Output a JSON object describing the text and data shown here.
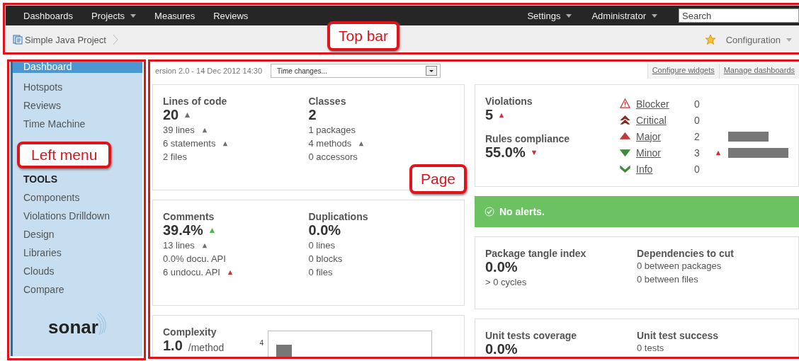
{
  "nav": {
    "items": [
      {
        "label": "Dashboards",
        "menu": false
      },
      {
        "label": "Projects",
        "menu": true
      },
      {
        "label": "Measures",
        "menu": false
      },
      {
        "label": "Reviews",
        "menu": false
      }
    ],
    "right": [
      {
        "label": "Settings",
        "menu": true
      },
      {
        "label": "Administrator",
        "menu": true
      }
    ],
    "search": {
      "placeholder": "Search"
    }
  },
  "breadcrumb": {
    "project": "Simple Java Project",
    "configuration": "Configuration"
  },
  "sidebar": {
    "items": [
      {
        "label": "Dashboard",
        "selected": true
      },
      {
        "label": "Hotspots",
        "selected": false
      },
      {
        "label": "Reviews",
        "selected": false
      },
      {
        "label": "Time Machine",
        "selected": false
      }
    ],
    "section": "TOOLS",
    "tools": [
      {
        "label": "Components",
        "selected": false
      },
      {
        "label": "Violations Drilldown",
        "selected": false
      },
      {
        "label": "Design",
        "selected": false
      },
      {
        "label": "Libraries",
        "selected": false
      },
      {
        "label": "Clouds",
        "selected": false
      },
      {
        "label": "Compare",
        "selected": false
      }
    ],
    "logo": "sonar"
  },
  "header": {
    "version": "ersion 2.0 - 14 Dec 2012 14:30",
    "time_select": "Time changes...",
    "links": [
      "Configure widgets",
      "Manage dashboards"
    ]
  },
  "left_widgets": [
    {
      "kind": "metrics",
      "columns": [
        {
          "title": "Lines of code",
          "value": "20",
          "trend": {
            "kind": "up",
            "color": "#6f6f6f"
          },
          "lines": [
            {
              "text": "39 lines",
              "trend": {
                "kind": "up",
                "color": "#6f6f6f"
              }
            },
            {
              "text": "6 statements",
              "trend": {
                "kind": "up",
                "color": "#6f6f6f"
              }
            },
            {
              "text": "2 files"
            }
          ]
        },
        {
          "title": "Classes",
          "value": "2",
          "lines": [
            {
              "text": "1 packages"
            },
            {
              "text": "4 methods",
              "trend": {
                "kind": "up",
                "color": "#6f6f6f"
              }
            },
            {
              "text": "0 accessors"
            }
          ]
        }
      ]
    },
    {
      "kind": "metrics",
      "columns": [
        {
          "title": "Comments",
          "value": "39.4%",
          "trend": {
            "kind": "up",
            "color": "#4fb848"
          },
          "lines": [
            {
              "text": "13 lines",
              "trend": {
                "kind": "up",
                "color": "#6f6f6f"
              }
            },
            {
              "text": "0.0% docu. API"
            },
            {
              "text": "6 undocu. API",
              "trend": {
                "kind": "up",
                "color": "#d0303a"
              }
            }
          ]
        },
        {
          "title": "Duplications",
          "value": "0.0%",
          "lines": [
            {
              "text": "0 lines"
            },
            {
              "text": "0 blocks"
            },
            {
              "text": "0 files"
            }
          ]
        }
      ]
    },
    {
      "kind": "complexity",
      "title": "Complexity",
      "value": "1.0",
      "unit": "/method",
      "chart_tick": "4"
    }
  ],
  "right_widgets": [
    {
      "kind": "violations",
      "title": "Violations",
      "value": "5",
      "trend": {
        "kind": "up",
        "color": "#d0303a"
      },
      "subtitle": "Rules compliance",
      "subvalue": "55.0%",
      "subtrend": {
        "kind": "down",
        "color": "#d0303a"
      },
      "severities": [
        {
          "kind": "blocker",
          "label": "Blocker",
          "count": "0"
        },
        {
          "kind": "critical",
          "label": "Critical",
          "count": "0"
        },
        {
          "kind": "major",
          "label": "Major",
          "count": "2"
        },
        {
          "kind": "minor",
          "label": "Minor",
          "count": "3",
          "trend": {
            "kind": "up",
            "color": "#d0303a"
          }
        },
        {
          "kind": "info",
          "label": "Info",
          "count": "0"
        }
      ]
    },
    {
      "kind": "alert",
      "text": "No alerts."
    },
    {
      "kind": "metrics",
      "columns": [
        {
          "title": "Package tangle index",
          "value": "0.0%",
          "lines": [
            {
              "text": "> 0 cycles"
            }
          ]
        },
        {
          "title": "Dependencies to cut",
          "lines": [
            {
              "text": "0 between packages"
            },
            {
              "text": "0 between files"
            }
          ]
        }
      ]
    },
    {
      "kind": "metrics",
      "columns": [
        {
          "title": "Unit tests coverage",
          "value": "0.0%"
        },
        {
          "title": "Unit test success",
          "lines": [
            {
              "text": "0 tests"
            }
          ]
        }
      ]
    }
  ],
  "annotations": [
    {
      "label": "Top bar"
    },
    {
      "label": "Left menu"
    },
    {
      "label": "Page"
    }
  ]
}
